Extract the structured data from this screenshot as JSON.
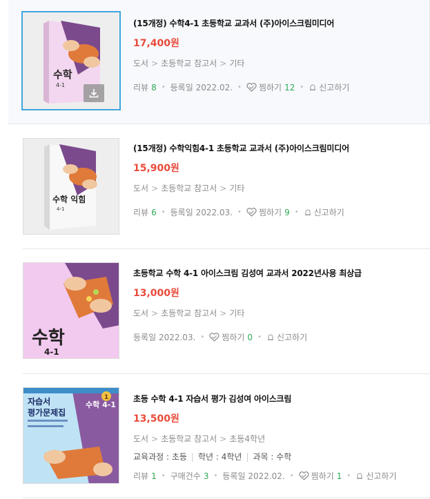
{
  "items": [
    {
      "title": "(15개정) 수학4-1 초등학교 교과서 (주)아이스크림미디어",
      "price": "17,400원",
      "category": [
        "도서",
        "초등학교 참고서",
        "기타"
      ],
      "review_label": "리뷰",
      "review_count": "8",
      "date_label": "등록일",
      "date": "2022.02.",
      "like_label": "찜하기",
      "like_count": "12",
      "report_label": "신고하기",
      "cover_text": "수학",
      "cover_sub": "4-1"
    },
    {
      "title": "(15개정) 수학익힘4-1 초등학교 교과서 (주)아이스크림미디어",
      "price": "15,900원",
      "category": [
        "도서",
        "초등학교 참고서",
        "기타"
      ],
      "review_label": "리뷰",
      "review_count": "6",
      "date_label": "등록일",
      "date": "2022.03.",
      "like_label": "찜하기",
      "like_count": "9",
      "report_label": "신고하기",
      "cover_text": "수학 익힘",
      "cover_sub": "4-1"
    },
    {
      "title": "초등학교 수학 4-1 아이스크림 김성여 교과서 2022년사용 최상급",
      "price": "13,000원",
      "category": [
        "도서",
        "초등학교 참고서",
        "기타"
      ],
      "date_label": "등록일",
      "date": "2022.03.",
      "like_label": "찜하기",
      "like_count": "0",
      "report_label": "신고하기",
      "cover_text": "수학",
      "cover_sub": "4-1"
    },
    {
      "title": "초등 수학 4-1 자습서 평가 김성여 아이스크림",
      "price": "13,500원",
      "category": [
        "도서",
        "초등학교 참고서",
        "초등4학년"
      ],
      "attrs": [
        "교육과정 : 초등",
        "학년 : 4학년",
        "과목 : 수학"
      ],
      "review_label": "리뷰",
      "review_count": "1",
      "purchase_label": "구매건수",
      "purchase_count": "3",
      "date_label": "등록일",
      "date": "2022.02.",
      "like_label": "찜하기",
      "like_count": "1",
      "report_label": "신고하기",
      "cover_text": "자습서 평가문제집",
      "cover_title_line1": "자습서",
      "cover_title_line2": "평가문제집",
      "cover_right": "수학 4-1",
      "cover_number": "1"
    }
  ],
  "colors": {
    "price": "#e84b3c",
    "count": "#2eaa55",
    "selected": "#3ea5dd",
    "cover_pink": "#f2c9ef",
    "cover_purple": "#7b4a8c"
  },
  "icons": {
    "download": "download-icon",
    "like": "heart-icon",
    "report": "bell-icon"
  }
}
